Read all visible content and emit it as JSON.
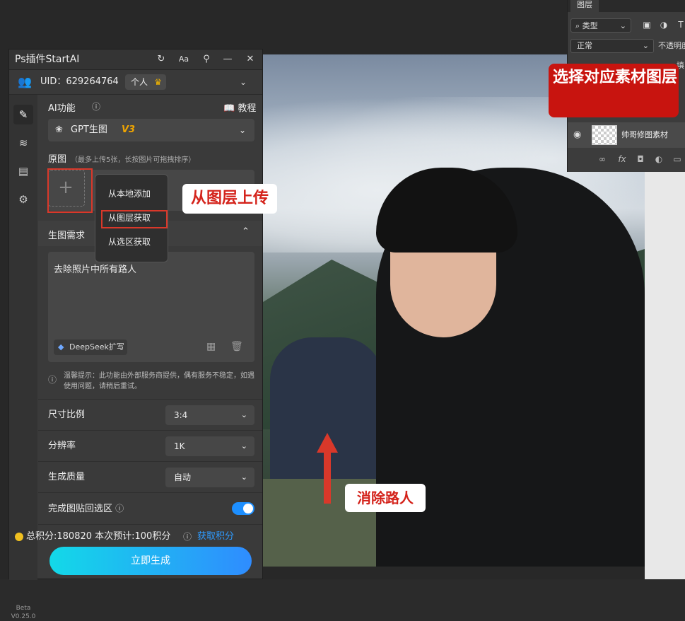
{
  "layers_panel": {
    "tab": "图层",
    "filter_label": "类型",
    "blend_mode": "正常",
    "opacity_label": "不透明度",
    "fill_label": "填",
    "layer_name": "帅哥修图素材"
  },
  "annotations": {
    "select_layer": "选择对应素材图层",
    "upload_from_layer": "从图层上传",
    "remove_people": "消除路人"
  },
  "plugin": {
    "title": "Ps插件StartAI",
    "uid": "UID：629264764",
    "account_type": "个人",
    "ai_function_label": "AI功能",
    "tutorial_label": "教程",
    "model_name": "GPT生图",
    "model_version": "V3",
    "source_label": "原图",
    "source_hint": "（最多上传5张，长按图片可拖拽排序）",
    "upload_menu": [
      "从本地添加",
      "从图层获取",
      "从选区获取"
    ],
    "requirement_label": "生图需求",
    "requirement_text": "去除照片中所有路人",
    "deepseek_label": "DeepSeek扩写",
    "tip_text": "温馨提示：此功能由外部服务商提供，偶有服务不稳定，如遇使用问题，请稍后重试。",
    "size_ratio_label": "尺寸比例",
    "size_ratio_value": "3:4",
    "resolution_label": "分辨率",
    "resolution_value": "1K",
    "quality_label": "生成质量",
    "quality_value": "自动",
    "paste_back_label": "完成图贴回选区",
    "paste_back_enabled": true,
    "points_text": "总积分:180820  本次预计:100积分",
    "get_points_label": "获取积分",
    "generate_label": "立即生成",
    "version_beta": "Beta",
    "version_number": "V0.25.0"
  },
  "colors": {
    "accent_red": "#d9382a",
    "link_blue": "#2e9bff",
    "toggle_on": "#1d8fff",
    "version_gold": "#f0a500"
  }
}
